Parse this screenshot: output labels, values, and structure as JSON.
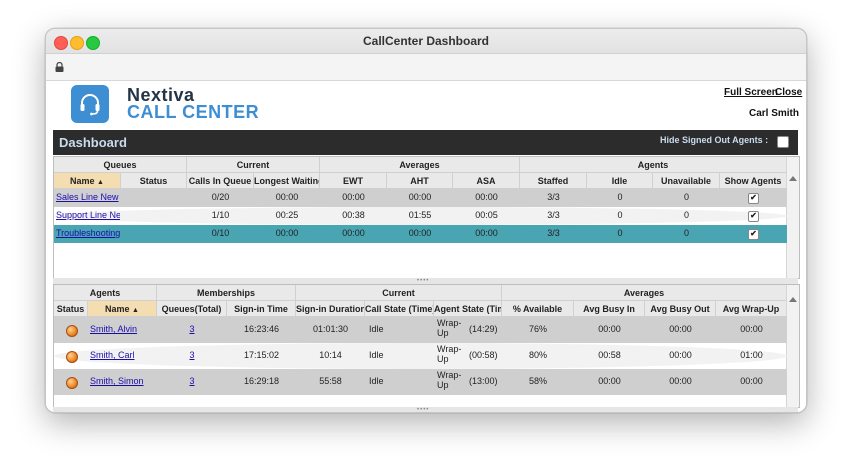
{
  "window": {
    "title": "CallCenter Dashboard"
  },
  "brand": {
    "line1": "Nextiva",
    "line2": "CALL CENTER",
    "logo_icon": "headset-icon",
    "accent": "#3e8ed3"
  },
  "header": {
    "full_screen": "Full Screen",
    "close": "Close",
    "user": "Carl Smith"
  },
  "dashboard": {
    "title": "Dashboard",
    "hide_label": "Hide Signed Out Agents :",
    "hide_checked": false
  },
  "queues": {
    "groups": [
      "Queues",
      "Current",
      "Averages",
      "Agents"
    ],
    "columns": [
      "Name",
      "Status",
      "Calls In Queue",
      "Longest Waiting",
      "EWT",
      "AHT",
      "ASA",
      "Staffed",
      "Idle",
      "Unavailable",
      "Show Agents"
    ],
    "sorted_column": "Name",
    "rows": [
      {
        "name": "Sales Line New",
        "status": "",
        "calls": "0/20",
        "longest": "00:00",
        "ewt": "00:00",
        "aht": "00:00",
        "asa": "00:00",
        "staffed": "3/3",
        "idle": "0",
        "unavailable": "0",
        "show": "✔"
      },
      {
        "name": "Support Line Ne",
        "status": "",
        "calls": "1/10",
        "longest": "00:25",
        "ewt": "00:38",
        "aht": "01:55",
        "asa": "00:05",
        "staffed": "3/3",
        "idle": "0",
        "unavailable": "0",
        "show": "✔"
      },
      {
        "name": "Troubleshooting",
        "status": "",
        "calls": "0/10",
        "longest": "00:00",
        "ewt": "00:00",
        "aht": "00:00",
        "asa": "00:00",
        "staffed": "3/3",
        "idle": "0",
        "unavailable": "0",
        "show": "✔"
      }
    ]
  },
  "agents": {
    "groups": [
      "Agents",
      "Memberships",
      "Current",
      "Averages"
    ],
    "columns": [
      "Status",
      "Name",
      "Queues(Total)",
      "Sign-in Time",
      "Sign-in Duration",
      "Call State (Time)",
      "Agent State (Time)",
      "% Available",
      "Avg Busy In",
      "Avg Busy Out",
      "Avg Wrap-Up"
    ],
    "sorted_column": "Name",
    "rows": [
      {
        "name": "Smith, Alvin",
        "queues": "3",
        "signin": "16:23:46",
        "duration": "01:01:30",
        "call_state": "Idle",
        "agent_state_1": "Wrap-",
        "agent_state_2": "Up",
        "agent_time": "(14:29)",
        "available": "76%",
        "busy_in": "00:00",
        "busy_out": "00:00",
        "wrap": "00:00"
      },
      {
        "name": "Smith, Carl",
        "queues": "3",
        "signin": "17:15:02",
        "duration": "10:14",
        "call_state": "Idle",
        "agent_state_1": "Wrap-",
        "agent_state_2": "Up",
        "agent_time": "(00:58)",
        "available": "80%",
        "busy_in": "00:58",
        "busy_out": "00:00",
        "wrap": "01:00"
      },
      {
        "name": "Smith, Simon",
        "queues": "3",
        "signin": "16:29:18",
        "duration": "55:58",
        "call_state": "Idle",
        "agent_state_1": "Wrap-",
        "agent_state_2": "Up",
        "agent_time": "(13:00)",
        "available": "58%",
        "busy_in": "00:00",
        "busy_out": "00:00",
        "wrap": "00:00"
      }
    ]
  }
}
